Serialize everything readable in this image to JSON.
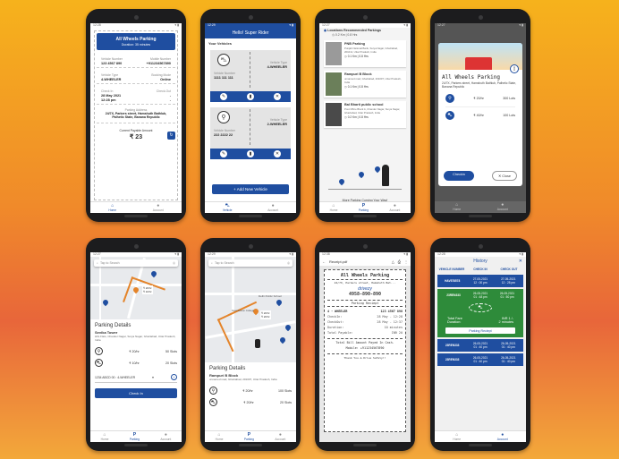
{
  "nav": {
    "home": "Home",
    "account": "Account",
    "vehicle": "Vehicle",
    "parking": "Parking"
  },
  "s1": {
    "title": "All Wheels Parking",
    "duration": "Duration: 35 minutes",
    "vehicle_number_lbl": "Vehicle Number",
    "vehicle_number": "123 4567 890",
    "mobile_lbl": "Mobile Number",
    "mobile": "+911234567890",
    "vehicle_type_lbl": "Vehicle Type",
    "vehicle_type": "4-WHEELER",
    "booking_mode_lbl": "Booking Mode",
    "booking_mode": "Online",
    "checkin_lbl": "Check In",
    "checkin_date": "28 May 2021",
    "checkin_time": "12:28 pm",
    "checkout_lbl": "Check-Out",
    "checkout_date": "-",
    "checkout_time": "-",
    "address_lbl": "Parking Address",
    "address": "24/7X, Parkers street, Hamshuth Bathlub, Palhetic State, Banana Republic",
    "payable_lbl": "Current Payable Amount",
    "payable": "₹ 23"
  },
  "s2": {
    "header": "Hello! Super Rider",
    "section": "Your Vehicles",
    "vehicles": [
      {
        "num_lbl": "Vehicle Number",
        "num": "1111 111 111",
        "type_lbl": "Vehicle Type",
        "type": "4-WHEELER"
      },
      {
        "num_lbl": "Vehicle Number",
        "num": "222 2222 22",
        "type_lbl": "Vehicle Type",
        "type": "2-WHEELER"
      }
    ],
    "add_btn": "+ Add New Vehicle"
  },
  "s3": {
    "header": "Locations Recommended Parkings",
    "top_dist": "0.2 Km | 0.8 Hrs",
    "items": [
      {
        "name": "PNB Parking",
        "addr": "Punjab National Bank, Surya Nagar, Ghaziabad, 201011, Uttar Pradesh, India",
        "dist": "0.1 Km | 0.8 Hrs"
      },
      {
        "name": "Rampuri B Block",
        "addr": "unnamed road, Ghaziabad, 201007, Uttar Pradesh, India",
        "dist": "0.1 Km | 0.8 Hrs"
      },
      {
        "name": "Bal Bharti public school",
        "addr": "Post Office Block A, Chander Nagar, Surya Nagar, Ghaziabad, Uttar Pradesh, India",
        "dist": "0.2 Km | 0.8 Hrs"
      }
    ],
    "tagline": "More Parking Coming Your Way!"
  },
  "s4": {
    "title": "All Wheels Parking",
    "addr": "24/7X, Parkers street, Hamshuth Bathlub, Palhetic State, Banana Republic",
    "rates": [
      {
        "rate": "₹ 20/hr",
        "lots": "300 Lots"
      },
      {
        "rate": "₹ 40/hr",
        "lots": "100 Lots"
      }
    ],
    "checkin": "Checkin",
    "close": "Close"
  },
  "s5": {
    "search": "Tap to Search",
    "heading": "Parking Details",
    "place": "Sevika Tower",
    "addr": "HIG Flats, Chander Nagar, Surya Nagar, Ghaziabad, Uttar Pradesh, India",
    "rates": [
      {
        "rate": "₹ 20/hr",
        "slots": "50 Slots"
      },
      {
        "rate": "₹ 10/hr",
        "slots": "20 Slots"
      }
    ],
    "vehicle_sel": "1234 ABCD 00 : 4-WHEELER",
    "checkin": "Check In",
    "pin_a": "₹ 20/hr",
    "pin_b": "₹ 10/hr"
  },
  "s6": {
    "search": "Tap to Search",
    "heading": "Parking Details",
    "place": "Rampuri B Block",
    "addr": "unnamed road, Ghaziabad, 201007, Uttar Pradesh, India",
    "rates": [
      {
        "rate": "₹ 20/hr",
        "slots": "100 Slots"
      },
      {
        "rate": "₹ 20/hr",
        "slots": "20 Slots"
      }
    ],
    "map_label": "Delhi Public School",
    "map_label2": "Gaurdvision College",
    "pin_a": "₹ 20/hr",
    "pin_b": "₹ 20/hr"
  },
  "s7": {
    "file": "Receipt.pdf",
    "title": "All Wheels Parking",
    "addr": "24/7X, Parkers street, Hamshuth Bat...",
    "brand": "drivezy",
    "phone": "4958-890-890",
    "receipt": "Parking Reciept",
    "rows": [
      {
        "k": "4 - WHEELER",
        "v": "123 4567 890"
      },
      {
        "k": "CheckIn:",
        "v": "28 May - 12:28"
      },
      {
        "k": "CheckOut:",
        "v": "28 May - 12:37"
      },
      {
        "k": "Duration:",
        "v": "10 minutes"
      },
      {
        "k": "Total Payable:",
        "v": "INR 20"
      }
    ],
    "paid": "Total Bill Amount Payed In Cash.",
    "mobile": "Mobile: +911234567890",
    "thanks": "Thank You & Drive Safely!!"
  },
  "s8": {
    "title": "History",
    "cols": [
      "VEHICLE NUMBER",
      "CHECK IN",
      "CHECK OUT"
    ],
    "rows": [
      {
        "num": "HAV578578",
        "in_d": "27-05-2021",
        "in_t": "12 : 00 pm",
        "out_d": "27-05-2021",
        "out_t": "12 : 28 pm"
      }
    ],
    "expanded": {
      "num": "23REN333",
      "in_d": "26-05-2021",
      "in_t": "01 : 48 pm",
      "out_d": "26-05-2021",
      "out_t": "01 : 50 pm",
      "fare_lbl": "Total Fare",
      "fare": "INR 1 /-",
      "dur_lbl": "Duration:",
      "dur": "2 minutes",
      "btn": "Parking Reciept"
    },
    "rows_after": [
      {
        "num": "23REN333",
        "in_d": "26-05-2021",
        "in_t": "01 : 40 pm",
        "out_d": "26-05-2021",
        "out_t": "01 : 40 pm"
      },
      {
        "num": "23REN333",
        "in_d": "26-05-2021",
        "in_t": "01 : 40 pm",
        "out_d": "26-05-2021",
        "out_t": "01 : 40 pm"
      }
    ]
  }
}
